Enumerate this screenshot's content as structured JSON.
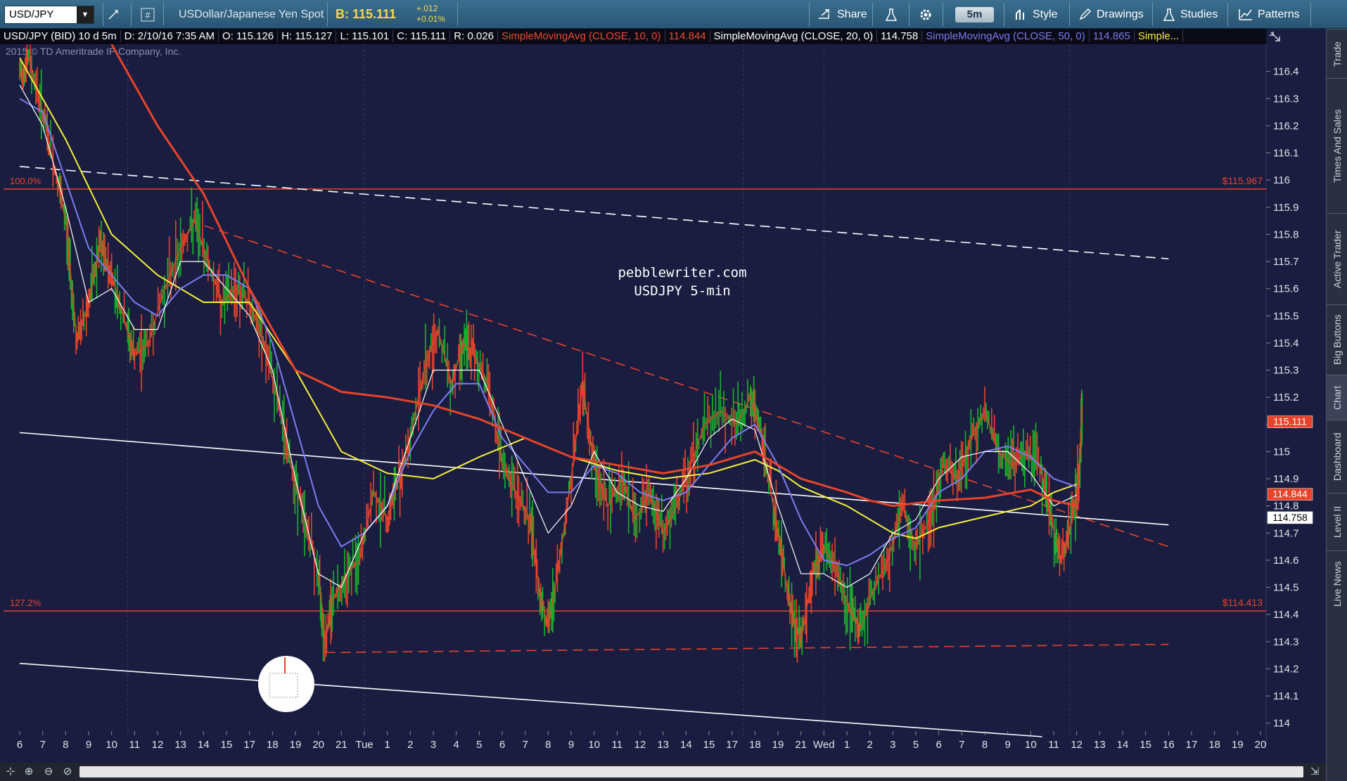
{
  "toolbar": {
    "symbol": "USD/JPY",
    "description": "USDollar/Japanese Yen Spot",
    "bid_label": "B: 115.111",
    "change": "+.012",
    "change_pct": "+0.01%",
    "share_label": "Share",
    "timeframe": "5m",
    "style_label": "Style",
    "drawings_label": "Drawings",
    "studies_label": "Studies",
    "patterns_label": "Patterns"
  },
  "studybar": {
    "instrument": "USD/JPY (BID) 10 d 5m",
    "date": "D: 2/10/16 7:35 AM",
    "open": "O: 115.126",
    "high": "H: 115.127",
    "low": "L: 115.101",
    "close": "C: 115.111",
    "range": "R: 0.026",
    "sma10": "SimpleMovingAvg (CLOSE, 10, 0)",
    "sma10_val": "114.844",
    "sma20": "SimpleMovingAvg (CLOSE, 20, 0)",
    "sma20_val": "114.758",
    "sma50": "SimpleMovingAvg (CLOSE, 50, 0)",
    "sma50_val": "114.865",
    "more": "Simple..."
  },
  "right_tabs": [
    "Trade",
    "Times And Sales",
    "Active Trader",
    "Big Buttons",
    "Chart",
    "Dashboard",
    "Level II",
    "Live News"
  ],
  "chart_data": {
    "type": "line",
    "copyright": "2015 © TD Ameritrade IP Company, Inc.",
    "watermark": [
      "pebblewriter.com",
      "USDJPY 5-min"
    ],
    "ylim": [
      113.95,
      116.5
    ],
    "y_ticks": [
      "116.4",
      "116.3",
      "116.2",
      "116.1",
      "116",
      "115.9",
      "115.8",
      "115.7",
      "115.6",
      "115.5",
      "115.4",
      "115.3",
      "115.2",
      "115.1",
      "115",
      "114.9",
      "114.8",
      "114.7",
      "114.6",
      "114.5",
      "114.4",
      "114.3",
      "114.2",
      "114.1",
      "114"
    ],
    "x_ticks": [
      "6",
      "7",
      "8",
      "9",
      "10",
      "11",
      "12",
      "13",
      "14",
      "15",
      "17",
      "18",
      "19",
      "20",
      "21",
      "Tue",
      "1",
      "2",
      "3",
      "4",
      "5",
      "6",
      "7",
      "8",
      "9",
      "10",
      "11",
      "12",
      "13",
      "14",
      "15",
      "17",
      "18",
      "19",
      "21",
      "Wed",
      "1",
      "2",
      "3",
      "5",
      "6",
      "7",
      "8",
      "9",
      "10",
      "11",
      "12",
      "13",
      "14",
      "15",
      "16",
      "17",
      "18",
      "19",
      "20"
    ],
    "fib_levels": [
      {
        "left_label": "100.0%",
        "right_label": "$115.967",
        "value": 115.967,
        "color": "#e8432a"
      },
      {
        "left_label": "127.2%",
        "right_label": "$114.413",
        "value": 114.413,
        "color": "#e8432a"
      }
    ],
    "price_flags": [
      {
        "label": "115.111",
        "value": 115.111,
        "bg": "#e8432a",
        "fg": "#ffffff"
      },
      {
        "label": "114.844",
        "value": 114.844,
        "bg": "#e8432a",
        "fg": "#ffffff"
      },
      {
        "label": "114.758",
        "value": 114.758,
        "bg": "#ffffff",
        "fg": "#000000"
      }
    ],
    "price_path": [
      [
        0,
        116.38
      ],
      [
        0.4,
        116.45
      ],
      [
        1,
        116.25
      ],
      [
        1.5,
        116.05
      ],
      [
        2,
        115.85
      ],
      [
        2.5,
        115.4
      ],
      [
        3,
        115.55
      ],
      [
        3.5,
        115.75
      ],
      [
        4,
        115.65
      ],
      [
        4.5,
        115.5
      ],
      [
        5,
        115.35
      ],
      [
        5.6,
        115.4
      ],
      [
        6.3,
        115.6
      ],
      [
        7,
        115.75
      ],
      [
        7.6,
        115.85
      ],
      [
        8.2,
        115.7
      ],
      [
        8.8,
        115.55
      ],
      [
        9.4,
        115.6
      ],
      [
        10,
        115.55
      ],
      [
        10.6,
        115.4
      ],
      [
        11.2,
        115.2
      ],
      [
        11.8,
        114.95
      ],
      [
        12.4,
        114.75
      ],
      [
        13,
        114.55
      ],
      [
        13.3,
        114.3
      ],
      [
        13.6,
        114.45
      ],
      [
        14.2,
        114.55
      ],
      [
        14.8,
        114.6
      ],
      [
        15.4,
        114.85
      ],
      [
        16,
        114.75
      ],
      [
        16.5,
        114.9
      ],
      [
        17,
        115.05
      ],
      [
        17.6,
        115.3
      ],
      [
        18.2,
        115.45
      ],
      [
        18.8,
        115.25
      ],
      [
        19.3,
        115.4
      ],
      [
        19.8,
        115.35
      ],
      [
        20.4,
        115.25
      ],
      [
        21,
        114.95
      ],
      [
        21.6,
        114.85
      ],
      [
        22.2,
        114.75
      ],
      [
        22.6,
        114.5
      ],
      [
        23,
        114.35
      ],
      [
        23.5,
        114.6
      ],
      [
        24,
        114.9
      ],
      [
        24.5,
        115.25
      ],
      [
        25,
        114.95
      ],
      [
        25.6,
        114.8
      ],
      [
        26.2,
        114.9
      ],
      [
        26.8,
        114.75
      ],
      [
        27.4,
        114.85
      ],
      [
        28,
        114.7
      ],
      [
        28.6,
        114.8
      ],
      [
        29.2,
        114.95
      ],
      [
        29.8,
        115.1
      ],
      [
        30.5,
        115.15
      ],
      [
        31.2,
        115.1
      ],
      [
        31.8,
        115.2
      ],
      [
        32.3,
        115.05
      ],
      [
        32.8,
        114.8
      ],
      [
        33.2,
        114.6
      ],
      [
        33.6,
        114.4
      ],
      [
        34,
        114.3
      ],
      [
        34.5,
        114.55
      ],
      [
        35,
        114.65
      ],
      [
        35.6,
        114.55
      ],
      [
        36.2,
        114.4
      ],
      [
        36.6,
        114.35
      ],
      [
        37.2,
        114.5
      ],
      [
        37.8,
        114.6
      ],
      [
        38.4,
        114.8
      ],
      [
        39,
        114.65
      ],
      [
        39.6,
        114.75
      ],
      [
        40.2,
        114.95
      ],
      [
        40.8,
        114.9
      ],
      [
        41.4,
        115.05
      ],
      [
        42,
        115.15
      ],
      [
        42.6,
        115.0
      ],
      [
        43.2,
        114.95
      ],
      [
        43.8,
        115.0
      ],
      [
        44.4,
        114.95
      ],
      [
        44.9,
        114.75
      ],
      [
        45.3,
        114.6
      ],
      [
        45.8,
        114.75
      ],
      [
        46.1,
        114.9
      ],
      [
        46.25,
        115.17
      ]
    ],
    "sma_fast_path": [
      [
        0,
        116.35
      ],
      [
        1,
        116.2
      ],
      [
        2,
        115.9
      ],
      [
        3,
        115.55
      ],
      [
        4,
        115.6
      ],
      [
        5,
        115.45
      ],
      [
        6,
        115.45
      ],
      [
        7,
        115.7
      ],
      [
        8,
        115.7
      ],
      [
        9,
        115.6
      ],
      [
        10,
        115.5
      ],
      [
        11,
        115.3
      ],
      [
        12,
        114.9
      ],
      [
        13,
        114.55
      ],
      [
        14,
        114.5
      ],
      [
        15,
        114.7
      ],
      [
        16,
        114.8
      ],
      [
        17,
        115.05
      ],
      [
        18,
        115.3
      ],
      [
        19,
        115.3
      ],
      [
        20,
        115.3
      ],
      [
        21,
        115.1
      ],
      [
        22,
        114.9
      ],
      [
        23,
        114.7
      ],
      [
        24,
        114.8
      ],
      [
        25,
        115.0
      ],
      [
        26,
        114.85
      ],
      [
        27,
        114.8
      ],
      [
        28,
        114.78
      ],
      [
        29,
        114.9
      ],
      [
        30,
        115.05
      ],
      [
        31,
        115.12
      ],
      [
        32,
        115.08
      ],
      [
        33,
        114.8
      ],
      [
        34,
        114.55
      ],
      [
        35,
        114.55
      ],
      [
        36,
        114.5
      ],
      [
        37,
        114.55
      ],
      [
        38,
        114.7
      ],
      [
        39,
        114.75
      ],
      [
        40,
        114.9
      ],
      [
        41,
        114.98
      ],
      [
        42,
        115.0
      ],
      [
        43,
        115.0
      ],
      [
        44,
        114.92
      ],
      [
        45,
        114.8
      ],
      [
        46,
        114.84
      ]
    ],
    "sma_mid_path": [
      [
        0,
        116.3
      ],
      [
        1,
        116.25
      ],
      [
        2,
        116.0
      ],
      [
        3,
        115.75
      ],
      [
        4,
        115.65
      ],
      [
        5,
        115.55
      ],
      [
        6,
        115.5
      ],
      [
        7,
        115.6
      ],
      [
        8,
        115.65
      ],
      [
        9,
        115.65
      ],
      [
        10,
        115.6
      ],
      [
        11,
        115.4
      ],
      [
        12,
        115.1
      ],
      [
        13,
        114.8
      ],
      [
        14,
        114.65
      ],
      [
        15,
        114.7
      ],
      [
        16,
        114.8
      ],
      [
        17,
        115.0
      ],
      [
        18,
        115.15
      ],
      [
        19,
        115.25
      ],
      [
        20,
        115.25
      ],
      [
        21,
        115.05
      ],
      [
        22,
        114.95
      ],
      [
        23,
        114.85
      ],
      [
        24,
        114.85
      ],
      [
        25,
        114.95
      ],
      [
        26,
        114.92
      ],
      [
        27,
        114.85
      ],
      [
        28,
        114.82
      ],
      [
        29,
        114.85
      ],
      [
        30,
        114.95
      ],
      [
        31,
        115.05
      ],
      [
        32,
        115.1
      ],
      [
        33,
        114.95
      ],
      [
        34,
        114.75
      ],
      [
        35,
        114.6
      ],
      [
        36,
        114.58
      ],
      [
        37,
        114.62
      ],
      [
        38,
        114.68
      ],
      [
        39,
        114.72
      ],
      [
        40,
        114.85
      ],
      [
        41,
        114.9
      ],
      [
        42,
        115.0
      ],
      [
        43,
        115.02
      ],
      [
        44,
        114.98
      ],
      [
        45,
        114.9
      ],
      [
        46,
        114.87
      ]
    ],
    "sma_slow_path": [
      [
        0,
        116.45
      ],
      [
        2,
        116.15
      ],
      [
        4,
        115.8
      ],
      [
        6,
        115.65
      ],
      [
        8,
        115.55
      ],
      [
        10,
        115.55
      ],
      [
        12,
        115.3
      ],
      [
        14,
        115.0
      ],
      [
        16,
        114.92
      ],
      [
        18,
        114.9
      ],
      [
        20,
        114.98
      ],
      [
        22,
        115.05
      ],
      [
        24,
        114.98
      ],
      [
        26,
        114.93
      ],
      [
        28,
        114.9
      ],
      [
        30,
        114.92
      ],
      [
        32,
        114.97
      ],
      [
        33,
        114.93
      ],
      [
        34,
        114.87
      ],
      [
        36,
        114.8
      ],
      [
        37,
        114.75
      ],
      [
        38,
        114.7
      ],
      [
        39,
        114.68
      ],
      [
        40,
        114.72
      ],
      [
        42,
        114.76
      ],
      [
        43,
        114.78
      ],
      [
        44,
        114.8
      ],
      [
        45,
        114.85
      ],
      [
        46,
        114.88
      ]
    ],
    "sma_long_path": [
      [
        4,
        116.5
      ],
      [
        6,
        116.2
      ],
      [
        8,
        115.95
      ],
      [
        10,
        115.6
      ],
      [
        12,
        115.3
      ],
      [
        14,
        115.22
      ],
      [
        16,
        115.2
      ],
      [
        18,
        115.17
      ],
      [
        20,
        115.12
      ],
      [
        22,
        115.05
      ],
      [
        24,
        114.98
      ],
      [
        26,
        114.95
      ],
      [
        28,
        114.92
      ],
      [
        30,
        114.95
      ],
      [
        32,
        115.0
      ],
      [
        33,
        114.95
      ],
      [
        34,
        114.9
      ],
      [
        36,
        114.85
      ],
      [
        37,
        114.82
      ],
      [
        38,
        114.8
      ],
      [
        40,
        114.82
      ],
      [
        42,
        114.83
      ],
      [
        44,
        114.86
      ],
      [
        45,
        114.82
      ],
      [
        46,
        114.8
      ]
    ],
    "trendlines": [
      {
        "name": "white-dashed-upper",
        "from": [
          0,
          116.05
        ],
        "to": [
          50,
          115.71
        ],
        "color": "#ffffff",
        "dash": true
      },
      {
        "name": "orange-dashed-upper",
        "from": [
          7.4,
          115.85
        ],
        "to": [
          50,
          114.65
        ],
        "color": "#e8432a",
        "dash": true
      },
      {
        "name": "orange-dashed-lower",
        "from": [
          13.3,
          114.26
        ],
        "to": [
          50,
          114.29
        ],
        "color": "#e8432a",
        "dash": true
      },
      {
        "name": "white-solid-mid",
        "from": [
          0,
          115.07
        ],
        "to": [
          50,
          114.73
        ],
        "color": "#ffffff",
        "dash": false
      },
      {
        "name": "white-solid-lower",
        "from": [
          0,
          114.22
        ],
        "to": [
          44.5,
          113.95
        ],
        "color": "#ffffff",
        "dash": false
      }
    ]
  }
}
